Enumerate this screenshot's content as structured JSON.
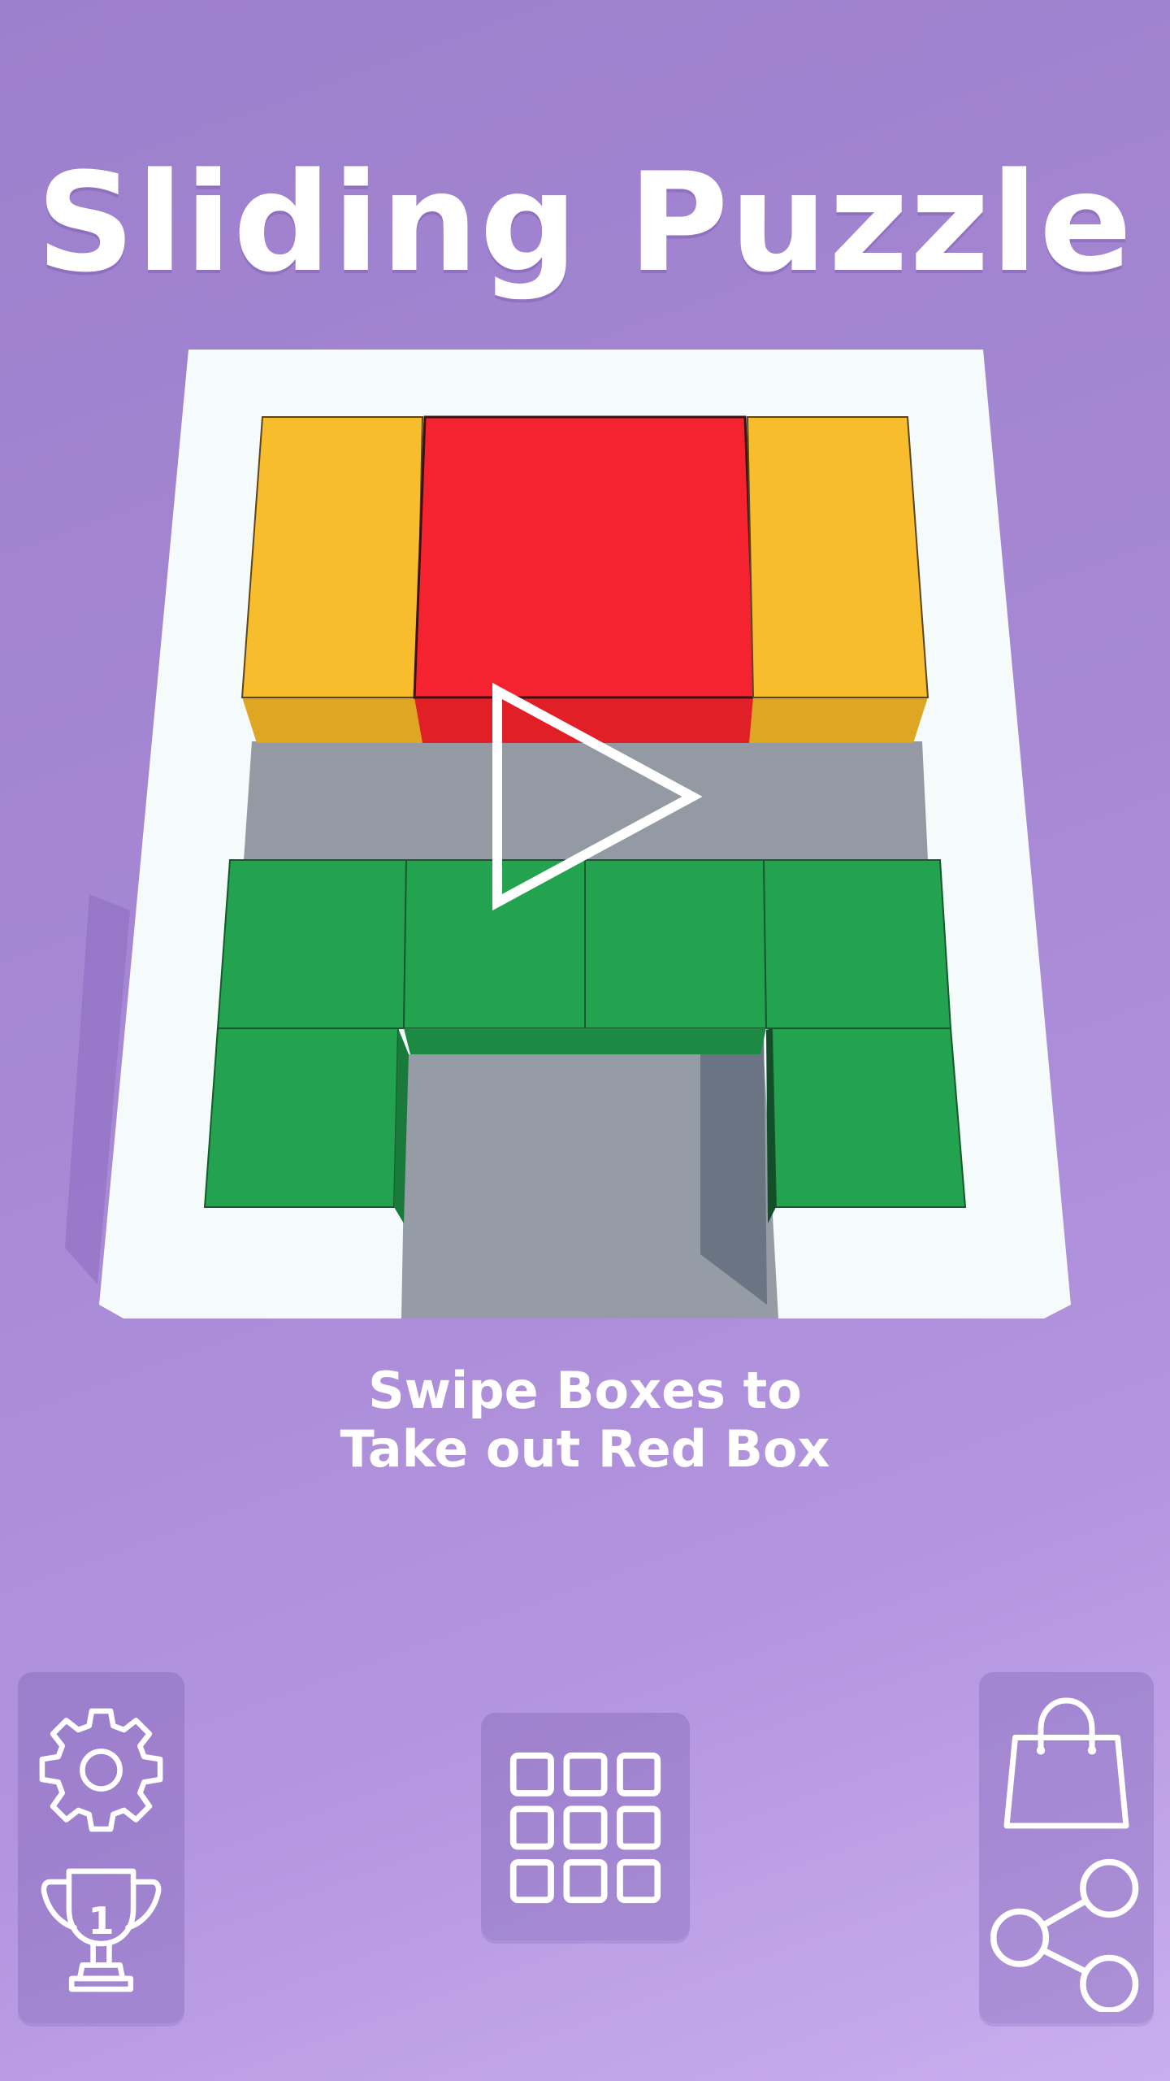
{
  "title": "Sliding Puzzle",
  "instructions": {
    "line1": "Swipe Boxes to",
    "line2": "Take out Red Box"
  },
  "leaderboard": {
    "rank": "1"
  },
  "colors": {
    "background_top": "#9d80cd",
    "background_bottom": "#c9aeef",
    "board": "#f5fbfb",
    "floor": "#9199a3",
    "yellow_block": "#f8bd2c",
    "red_block": "#f5222f",
    "green_block": "#23a350",
    "icon_stroke": "#ffffff"
  },
  "icons": {
    "play": "play-icon",
    "settings": "gear-icon",
    "leaderboard": "trophy-icon",
    "levels": "grid-icon",
    "shop": "shopping-bag-icon",
    "share": "share-icon"
  }
}
